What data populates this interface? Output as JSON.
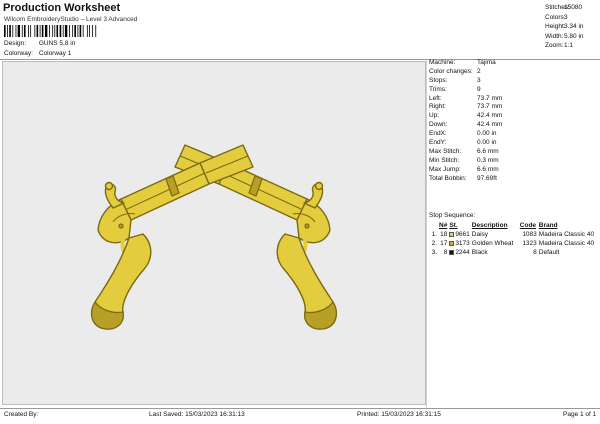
{
  "header": {
    "title": "Production Worksheet",
    "subtitle": "Wilcom EmbroideryStudio – Level 3 Advanced",
    "design_label": "Design:",
    "design_value": "GUNS 5,8 in",
    "colorway_label": "Colorway:",
    "colorway_value": "Colorway 1"
  },
  "stats": [
    {
      "label": "Stitches:",
      "value": "15080"
    },
    {
      "label": "Colors:",
      "value": "3"
    },
    {
      "label": "Height:",
      "value": "3.34 in"
    },
    {
      "label": "Width:",
      "value": "5.80 in"
    },
    {
      "label": "Zoom:",
      "value": "1:1"
    }
  ],
  "properties": [
    {
      "label": "Machine:",
      "value": "Tajima"
    },
    {
      "label": "Color changes:",
      "value": "2"
    },
    {
      "label": "Stops:",
      "value": "3"
    },
    {
      "label": "Trims:",
      "value": "9"
    },
    {
      "label": "Left:",
      "value": "73.7 mm"
    },
    {
      "label": "Right:",
      "value": "73.7 mm"
    },
    {
      "label": "Up:",
      "value": "42.4 mm"
    },
    {
      "label": "Down:",
      "value": "42.4 mm"
    },
    {
      "label": "EndX:",
      "value": "0.00 in"
    },
    {
      "label": "EndY:",
      "value": "0.00 in"
    },
    {
      "label": "Max Stitch:",
      "value": "6.6 mm"
    },
    {
      "label": "Min Stitch:",
      "value": "0.3 mm"
    },
    {
      "label": "Max Jump:",
      "value": "6.6 mm"
    },
    {
      "label": "Total Bobbin:",
      "value": "97.69ft"
    }
  ],
  "stop_sequence": {
    "title": "Stop Sequence:",
    "headers": {
      "n": "N#",
      "st": "St.",
      "description": "Description",
      "code": "Code",
      "brand": "Brand"
    },
    "rows": [
      {
        "stop": "1.",
        "n": "18",
        "color": "#e8d34c",
        "code_num": "9661",
        "description": "Daisy",
        "st": "1083",
        "brand": "Madeira Classic 40"
      },
      {
        "stop": "2.",
        "n": "17",
        "color": "#c9b13a",
        "code_num": "3173",
        "description": "Golden Wheat",
        "st": "1323",
        "brand": "Madeira Classic 40"
      },
      {
        "stop": "3.",
        "n": "8",
        "color": "#111111",
        "code_num": "2244",
        "description": "Black",
        "st": "8",
        "brand": "Default"
      }
    ]
  },
  "footer": {
    "created": "Created By:",
    "saved": "Last Saved: 15/03/2023 16:31:13",
    "printed": "Printed: 15/03/2023 16:31:15",
    "page": "Page 1 of 1"
  },
  "design_colors": {
    "fill": "#e3cc3e",
    "outline": "#7a6a12",
    "dark": "#b89f25"
  }
}
